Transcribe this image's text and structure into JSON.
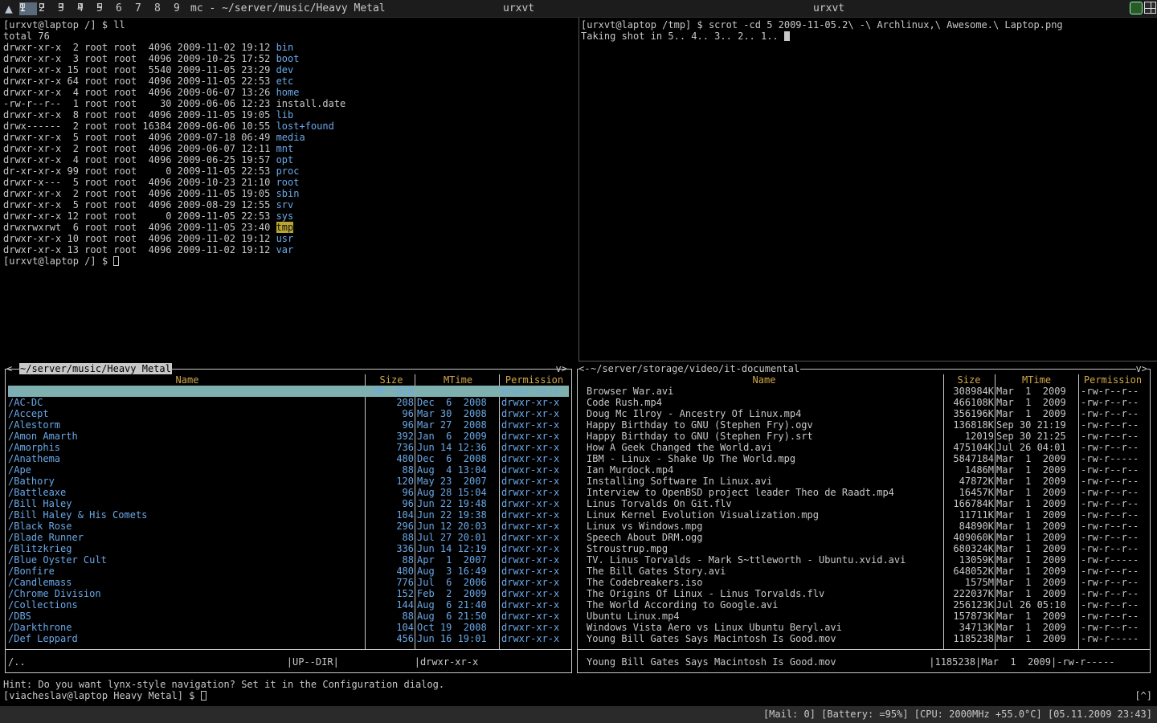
{
  "topbar": {
    "logo_icon": "arch-logo-icon",
    "tags": [
      "1",
      "2",
      "3",
      "4",
      "5",
      "6",
      "7",
      "8",
      "9"
    ],
    "selected_tag": "1",
    "left_title": "mc - ~/server/music/Heavy Metal",
    "center_title": "urxvt",
    "right_title": "urxvt"
  },
  "term_left": {
    "prompt": "[urxvt@laptop /] $ ll",
    "total": "total 76",
    "entries": [
      {
        "meta": "drwxr-xr-x  2 root root  4096 2009-11-02 19:12 ",
        "name": "bin",
        "kind": "dir"
      },
      {
        "meta": "drwxr-xr-x  3 root root  4096 2009-10-25 17:52 ",
        "name": "boot",
        "kind": "dir"
      },
      {
        "meta": "drwxr-xr-x 15 root root  5540 2009-11-05 23:29 ",
        "name": "dev",
        "kind": "dir"
      },
      {
        "meta": "drwxr-xr-x 64 root root  4096 2009-11-05 22:53 ",
        "name": "etc",
        "kind": "dir"
      },
      {
        "meta": "drwxr-xr-x  4 root root  4096 2009-06-07 13:26 ",
        "name": "home",
        "kind": "dir"
      },
      {
        "meta": "-rw-r--r--  1 root root    30 2009-06-06 12:23 ",
        "name": "install.date",
        "kind": "file"
      },
      {
        "meta": "drwxr-xr-x  8 root root  4096 2009-11-05 19:05 ",
        "name": "lib",
        "kind": "dir"
      },
      {
        "meta": "drwx------  2 root root 16384 2009-06-06 10:55 ",
        "name": "lost+found",
        "kind": "dir"
      },
      {
        "meta": "drwxr-xr-x  5 root root  4096 2009-07-18 06:49 ",
        "name": "media",
        "kind": "dir"
      },
      {
        "meta": "drwxr-xr-x  2 root root  4096 2009-06-07 12:11 ",
        "name": "mnt",
        "kind": "dir"
      },
      {
        "meta": "drwxr-xr-x  4 root root  4096 2009-06-25 19:57 ",
        "name": "opt",
        "kind": "dir"
      },
      {
        "meta": "dr-xr-xr-x 99 root root     0 2009-11-05 22:53 ",
        "name": "proc",
        "kind": "dir"
      },
      {
        "meta": "drwxr-x---  5 root root  4096 2009-10-23 21:10 ",
        "name": "root",
        "kind": "dir"
      },
      {
        "meta": "drwxr-xr-x  2 root root  4096 2009-11-05 19:05 ",
        "name": "sbin",
        "kind": "dir"
      },
      {
        "meta": "drwxr-xr-x  5 root root  4096 2009-08-29 12:55 ",
        "name": "srv",
        "kind": "dir"
      },
      {
        "meta": "drwxr-xr-x 12 root root     0 2009-11-05 22:53 ",
        "name": "sys",
        "kind": "dir"
      },
      {
        "meta": "drwxrwxrwt  6 root root  4096 2009-11-05 23:40 ",
        "name": "tmp",
        "kind": "tmp"
      },
      {
        "meta": "drwxr-xr-x 10 root root  4096 2009-11-02 19:12 ",
        "name": "usr",
        "kind": "dir"
      },
      {
        "meta": "drwxr-xr-x 13 root root  4096 2009-11-02 19:12 ",
        "name": "var",
        "kind": "dir"
      }
    ],
    "final_prompt": "[urxvt@laptop /] $ "
  },
  "term_right": {
    "line1": "[urxvt@laptop /tmp] $ scrot -cd 5 2009-11-05.2\\ -\\ Archlinux,\\ Awesome.\\ Laptop.png",
    "line2": "Taking shot in 5.. 4.. 3.. 2.. 1.. "
  },
  "mc_left": {
    "path": "~/server/music/Heavy Metal",
    "corner": "v>",
    "headers": {
      "name": "Name",
      "size": "Size",
      "mtime": "MTime",
      "perm": "Permission"
    },
    "rows": [
      {
        "name": "/..",
        "size": "UP--DIR",
        "mtime": "",
        "perm": "drwxr-xr-x"
      },
      {
        "name": "/AC-DC",
        "size": "208",
        "mtime": "Dec  6  2008",
        "perm": "drwxr-xr-x"
      },
      {
        "name": "/Accept",
        "size": "96",
        "mtime": "Mar 30  2008",
        "perm": "drwxr-xr-x"
      },
      {
        "name": "/Alestorm",
        "size": "96",
        "mtime": "Mar 27  2008",
        "perm": "drwxr-xr-x"
      },
      {
        "name": "/Amon Amarth",
        "size": "392",
        "mtime": "Jan  6  2009",
        "perm": "drwxr-xr-x"
      },
      {
        "name": "/Amorphis",
        "size": "736",
        "mtime": "Jun 14 12:36",
        "perm": "drwxr-xr-x"
      },
      {
        "name": "/Anathema",
        "size": "480",
        "mtime": "Dec  6  2008",
        "perm": "drwxr-xr-x"
      },
      {
        "name": "/Ape",
        "size": "88",
        "mtime": "Aug  4 13:04",
        "perm": "drwxr-xr-x"
      },
      {
        "name": "/Bathory",
        "size": "120",
        "mtime": "May 23  2007",
        "perm": "drwxr-xr-x"
      },
      {
        "name": "/Battleaxe",
        "size": "96",
        "mtime": "Aug 28 15:04",
        "perm": "drwxr-xr-x"
      },
      {
        "name": "/Bill Haley",
        "size": "96",
        "mtime": "Jun 22 19:48",
        "perm": "drwxr-xr-x"
      },
      {
        "name": "/Bill Haley & His Comets",
        "size": "104",
        "mtime": "Jun 22 19:38",
        "perm": "drwxr-xr-x"
      },
      {
        "name": "/Black Rose",
        "size": "296",
        "mtime": "Jun 12 20:03",
        "perm": "drwxr-xr-x"
      },
      {
        "name": "/Blade Runner",
        "size": "88",
        "mtime": "Jul 27 20:01",
        "perm": "drwxr-xr-x"
      },
      {
        "name": "/Blitzkrieg",
        "size": "336",
        "mtime": "Jun 14 12:19",
        "perm": "drwxr-xr-x"
      },
      {
        "name": "/Blue Oyster Cult",
        "size": "88",
        "mtime": "Apr  1  2007",
        "perm": "drwxr-xr-x"
      },
      {
        "name": "/Bonfire",
        "size": "480",
        "mtime": "Aug  3 16:49",
        "perm": "drwxr-xr-x"
      },
      {
        "name": "/Candlemass",
        "size": "776",
        "mtime": "Jul  6  2006",
        "perm": "drwxr-xr-x"
      },
      {
        "name": "/Chrome Division",
        "size": "152",
        "mtime": "Feb  2  2009",
        "perm": "drwxr-xr-x"
      },
      {
        "name": "/Collections",
        "size": "144",
        "mtime": "Aug  6 21:40",
        "perm": "drwxr-xr-x"
      },
      {
        "name": "/DBS",
        "size": "88",
        "mtime": "Aug  6 21:50",
        "perm": "drwxr-xr-x"
      },
      {
        "name": "/Darkthrone",
        "size": "104",
        "mtime": "Oct 19  2008",
        "perm": "drwxr-xr-x"
      },
      {
        "name": "/Def Leppard",
        "size": "456",
        "mtime": "Jun 16 19:01",
        "perm": "drwxr-xr-x"
      }
    ],
    "mini": "/..                                             |UP--DIR|             |drwxr-xr-x"
  },
  "mc_right": {
    "path": "~/server/storage/video/it-documental",
    "corner": "v>",
    "headers": {
      "name": "Name",
      "size": "Size",
      "mtime": "MTime",
      "perm": "Permission"
    },
    "rows": [
      {
        "name": "Browser War.avi",
        "size": "308984K",
        "mtime": "Mar  1  2009",
        "perm": "-rw-r--r--"
      },
      {
        "name": "Code Rush.mp4",
        "size": "466108K",
        "mtime": "Mar  1  2009",
        "perm": "-rw-r--r--"
      },
      {
        "name": "Doug Mc Ilroy - Ancestry Of Linux.mp4",
        "size": "356196K",
        "mtime": "Mar  1  2009",
        "perm": "-rw-r--r--"
      },
      {
        "name": "Happy Birthday to GNU (Stephen Fry).ogv",
        "size": "136818K",
        "mtime": "Sep 30 21:19",
        "perm": "-rw-r--r--"
      },
      {
        "name": "Happy Birthday to GNU (Stephen Fry).srt",
        "size": "12019",
        "mtime": "Sep 30 21:25",
        "perm": "-rw-r--r--"
      },
      {
        "name": "How A Geek Changed the World.avi",
        "size": "475104K",
        "mtime": "Jul 26 04:01",
        "perm": "-rw-r--r--"
      },
      {
        "name": "IBM - Linux - Shake Up The World.mpg",
        "size": "5847184",
        "mtime": "Mar  1  2009",
        "perm": "-rw-r-----"
      },
      {
        "name": "Ian Murdock.mp4",
        "size": "1486M",
        "mtime": "Mar  1  2009",
        "perm": "-rw-r--r--"
      },
      {
        "name": "Installing Software In Linux.avi",
        "size": "47872K",
        "mtime": "Mar  1  2009",
        "perm": "-rw-r--r--"
      },
      {
        "name": "Interview to OpenBSD project leader Theo de Raadt.mp4",
        "size": "16457K",
        "mtime": "Mar  1  2009",
        "perm": "-rw-r--r--"
      },
      {
        "name": "Linus Torvalds On Git.flv",
        "size": "166784K",
        "mtime": "Mar  1  2009",
        "perm": "-rw-r--r--"
      },
      {
        "name": "Linux Kernel Evolution Visualization.mpg",
        "size": "11711K",
        "mtime": "Mar  1  2009",
        "perm": "-rw-r--r--"
      },
      {
        "name": "Linux vs Windows.mpg",
        "size": "84890K",
        "mtime": "Mar  1  2009",
        "perm": "-rw-r--r--"
      },
      {
        "name": "Speech About DRM.ogg",
        "size": "409060K",
        "mtime": "Mar  1  2009",
        "perm": "-rw-r--r--"
      },
      {
        "name": "Stroustrup.mpg",
        "size": "680324K",
        "mtime": "Mar  1  2009",
        "perm": "-rw-r--r--"
      },
      {
        "name": "TV. Linus Torvalds - Mark S~ttleworth - Ubuntu.xvid.avi",
        "size": "13059K",
        "mtime": "Mar  1  2009",
        "perm": "-rw-r-----"
      },
      {
        "name": "The Bill Gates Story.avi",
        "size": "648052K",
        "mtime": "Mar  1  2009",
        "perm": "-rw-r--r--"
      },
      {
        "name": "The Codebreakers.iso",
        "size": "1575M",
        "mtime": "Mar  1  2009",
        "perm": "-rw-r--r--"
      },
      {
        "name": "The Origins Of Linux - Linus Torvalds.flv",
        "size": "222037K",
        "mtime": "Mar  1  2009",
        "perm": "-rw-r--r--"
      },
      {
        "name": "The World According to Google.avi",
        "size": "256123K",
        "mtime": "Jul 26 05:10",
        "perm": "-rw-r--r--"
      },
      {
        "name": "Ubuntu Linux.mp4",
        "size": "157873K",
        "mtime": "Mar  1  2009",
        "perm": "-rw-r--r--"
      },
      {
        "name": "Windows Vista Aero vs Linux Ubuntu Beryl.avi",
        "size": "34713K",
        "mtime": "Mar  1  2009",
        "perm": "-rw-r--r--"
      },
      {
        "name": "Young Bill Gates Says Macintosh Is Good.mov",
        "size": "1185238",
        "mtime": "Mar  1  2009",
        "perm": "-rw-r-----"
      }
    ],
    "mini": "Young Bill Gates Says Macintosh Is Good.mov                |1185238|Mar  1  2009|-rw-r-----"
  },
  "hint": "Hint: Do you want lynx-style navigation? Set it in the Configuration dialog.",
  "prompt2": "[viacheslav@laptop Heavy Metal] $ ",
  "cmd_history": "[^]",
  "statusbar": "[Mail: 0] [Battery: =95%] [CPU: 2000MHz +55.0°C] [05.11.2009 23:43]",
  "colors": {
    "dir": "#6aa8e8",
    "header": "#d2a64a",
    "highlight": "#7fb0b0",
    "tmp_bg": "#b9a52f"
  }
}
